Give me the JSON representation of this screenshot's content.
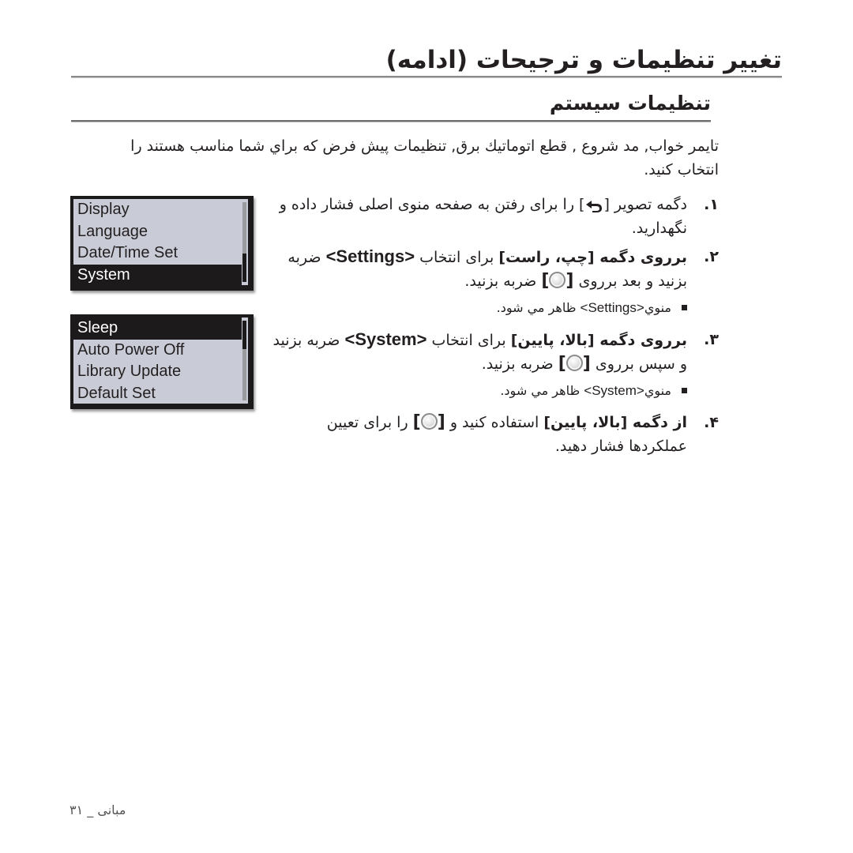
{
  "page": {
    "title": "تغییر تنظیمات و ترجیحات (ادامه)",
    "subtitle": "تنظیمات سیستم",
    "intro": "تایمر خواب, مد شروع , قطع اتوماتیك برق, تنظیمات پیش فرض كه براي شما مناسب هستند را انتخاب كنید."
  },
  "steps": [
    {
      "num": "۱.",
      "text_a": "دگمه تصویر [",
      "icon": "back-arrow-icon",
      "text_b": "] را برای رفتن به صفحه منوی اصلی فشار داده و نگهدارید."
    },
    {
      "num": "۲.",
      "text_a": "برروی دگمه [چپ، راست]",
      "text_b": " برای انتخاب ",
      "keyword": "<Settings>",
      "text_c": " ضربه بزنید و بعد برروی ",
      "bracket_open": "[",
      "icon": "select-button-icon",
      "bracket_close": "]",
      "text_d": " ضربه بزنید.",
      "note_prefix": "منوي",
      "note_keyword": "<Settings>",
      "note_suffix": " ظاهر مي شود."
    },
    {
      "num": "۳.",
      "text_a": "برروی دگمه [بالا، پایین]",
      "text_b": " برای انتخاب ",
      "keyword": "<System>",
      "text_c": " ضربه بزنید و سپس برروی ",
      "bracket_open": "[",
      "icon": "select-button-icon",
      "bracket_close": "]",
      "text_d": " ضربه بزنید.",
      "note_prefix": "منوي",
      "note_keyword": "<System>",
      "note_suffix": " ظاهر مي شود."
    },
    {
      "num": "۴.",
      "text_a": "از دگمه [بالا، پایین]",
      "text_b": " استفاده كنید و ",
      "bracket_open": "[",
      "icon": "select-button-icon",
      "bracket_close": "]",
      "text_c": " را برای  تعیین عملكردها فشار دهید."
    }
  ],
  "screens": [
    {
      "items": [
        "Display",
        "Language",
        "Date/Time Set",
        "System"
      ],
      "selected_index": 3,
      "scroll_position": "bottom"
    },
    {
      "items": [
        "Sleep",
        "Auto Power Off",
        "Library Update",
        "Default Set"
      ],
      "selected_index": 0,
      "scroll_position": "top"
    }
  ],
  "footer": {
    "section": "مبانی",
    "separator": "_",
    "page_number": "۳۱"
  }
}
